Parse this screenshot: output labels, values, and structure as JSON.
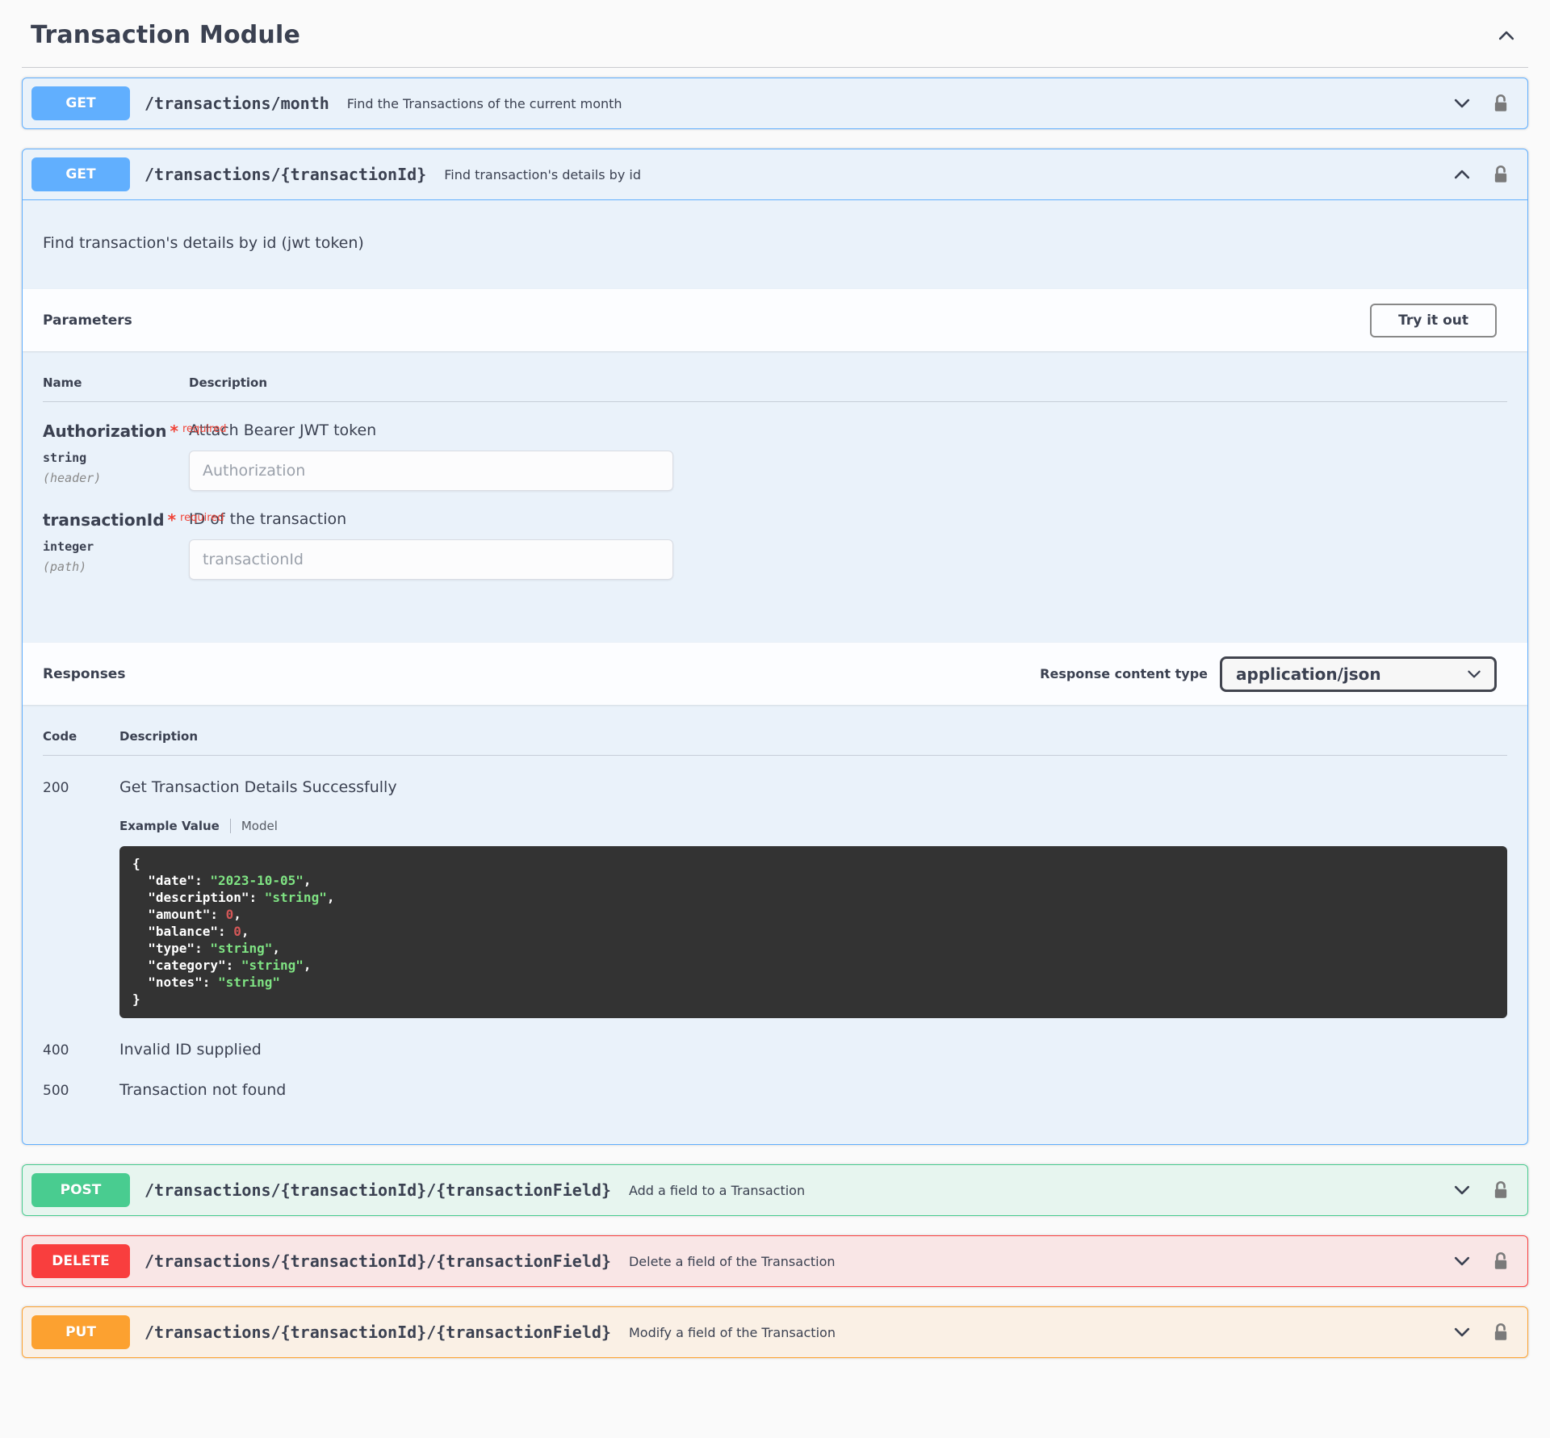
{
  "module": {
    "title": "Transaction Module"
  },
  "endpoints": [
    {
      "method": "GET",
      "path": "/transactions/month",
      "summary": "Find the Transactions of the current month"
    },
    {
      "method": "GET",
      "path": "/transactions/{transactionId}",
      "summary": "Find transaction's details by id"
    },
    {
      "method": "POST",
      "path": "/transactions/{transactionId}/{transactionField}",
      "summary": "Add a field to a Transaction"
    },
    {
      "method": "DELETE",
      "path": "/transactions/{transactionId}/{transactionField}",
      "summary": "Delete a field of the Transaction"
    },
    {
      "method": "PUT",
      "path": "/transactions/{transactionId}/{transactionField}",
      "summary": "Modify a field of the Transaction"
    }
  ],
  "expanded_operation": {
    "description": "Find transaction's details by id (jwt token)",
    "parameters": {
      "section_title": "Parameters",
      "try_it_out": "Try it out",
      "col_name": "Name",
      "col_description": "Description",
      "rows": [
        {
          "name": "Authorization",
          "required_star": "*",
          "required_label": "required",
          "type": "string",
          "located_in": "(header)",
          "description": "Attach Bearer JWT token",
          "placeholder": "Authorization"
        },
        {
          "name": "transactionId",
          "required_star": "*",
          "required_label": "required",
          "type": "integer",
          "located_in": "(path)",
          "description": "ID of the transaction",
          "placeholder": "transactionId"
        }
      ]
    },
    "responses": {
      "section_title": "Responses",
      "content_type_label": "Response content type",
      "content_type_value": "application/json",
      "col_code": "Code",
      "col_description": "Description",
      "rows": [
        {
          "code": "200",
          "description": "Get Transaction Details Successfully"
        },
        {
          "code": "400",
          "description": "Invalid ID supplied"
        },
        {
          "code": "500",
          "description": "Transaction not found"
        }
      ],
      "example_tabs": {
        "example": "Example Value",
        "model": "Model"
      },
      "example_json_lines": [
        [
          [
            "plain",
            "{"
          ]
        ],
        [
          [
            "key",
            "  \"date\""
          ],
          [
            "plain",
            ": "
          ],
          [
            "str",
            "\"2023-10-05\""
          ],
          [
            "plain",
            ","
          ]
        ],
        [
          [
            "key",
            "  \"description\""
          ],
          [
            "plain",
            ": "
          ],
          [
            "str",
            "\"string\""
          ],
          [
            "plain",
            ","
          ]
        ],
        [
          [
            "key",
            "  \"amount\""
          ],
          [
            "plain",
            ": "
          ],
          [
            "num",
            "0"
          ],
          [
            "plain",
            ","
          ]
        ],
        [
          [
            "key",
            "  \"balance\""
          ],
          [
            "plain",
            ": "
          ],
          [
            "num",
            "0"
          ],
          [
            "plain",
            ","
          ]
        ],
        [
          [
            "key",
            "  \"type\""
          ],
          [
            "plain",
            ": "
          ],
          [
            "str",
            "\"string\""
          ],
          [
            "plain",
            ","
          ]
        ],
        [
          [
            "key",
            "  \"category\""
          ],
          [
            "plain",
            ": "
          ],
          [
            "str",
            "\"string\""
          ],
          [
            "plain",
            ","
          ]
        ],
        [
          [
            "key",
            "  \"notes\""
          ],
          [
            "plain",
            ": "
          ],
          [
            "str",
            "\"string\""
          ]
        ],
        [
          [
            "plain",
            "}"
          ]
        ]
      ]
    }
  },
  "icons": {
    "section_toggle": "chevron-up-icon",
    "collapsed_row_toggle": "chevron-down-icon",
    "expanded_row_toggle": "chevron-up-icon",
    "auth": "unlock-icon",
    "select_caret": "chevron-down-icon"
  },
  "colors": {
    "get": "#61affe",
    "post": "#49cc90",
    "delete": "#f93e3e",
    "put": "#fca130",
    "text": "#3b4151",
    "required": "#f04438",
    "code_bg": "#333333",
    "code_key": "#ffffff",
    "code_string": "#7fe383",
    "code_number": "#d25757"
  }
}
